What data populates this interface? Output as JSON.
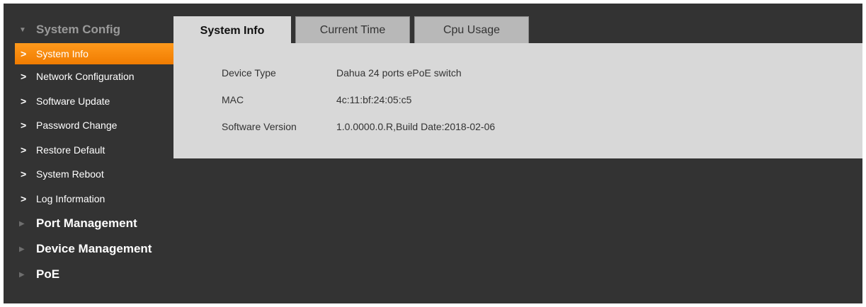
{
  "sidebar": {
    "system_config": {
      "label": "System Config",
      "items": [
        {
          "label": "System Info"
        },
        {
          "label": "Network Configuration"
        },
        {
          "label": "Software Update"
        },
        {
          "label": "Password Change"
        },
        {
          "label": "Restore Default"
        },
        {
          "label": "System Reboot"
        },
        {
          "label": "Log Information"
        }
      ]
    },
    "groups": [
      {
        "label": "Port Management"
      },
      {
        "label": "Device Management"
      },
      {
        "label": "PoE"
      }
    ]
  },
  "tabs": [
    {
      "label": "System Info"
    },
    {
      "label": "Current Time"
    },
    {
      "label": "Cpu Usage"
    }
  ],
  "info": {
    "device_type": {
      "label": "Device Type",
      "value": "Dahua 24 ports ePoE switch"
    },
    "mac": {
      "label": "MAC",
      "value": "4c:11:bf:24:05:c5"
    },
    "software_version": {
      "label": "Software Version",
      "value": "1.0.0000.0.R,Build Date:2018-02-06"
    }
  },
  "colors": {
    "background": "#333333",
    "accent": "#f7890c",
    "panel": "#d8d8d8"
  }
}
